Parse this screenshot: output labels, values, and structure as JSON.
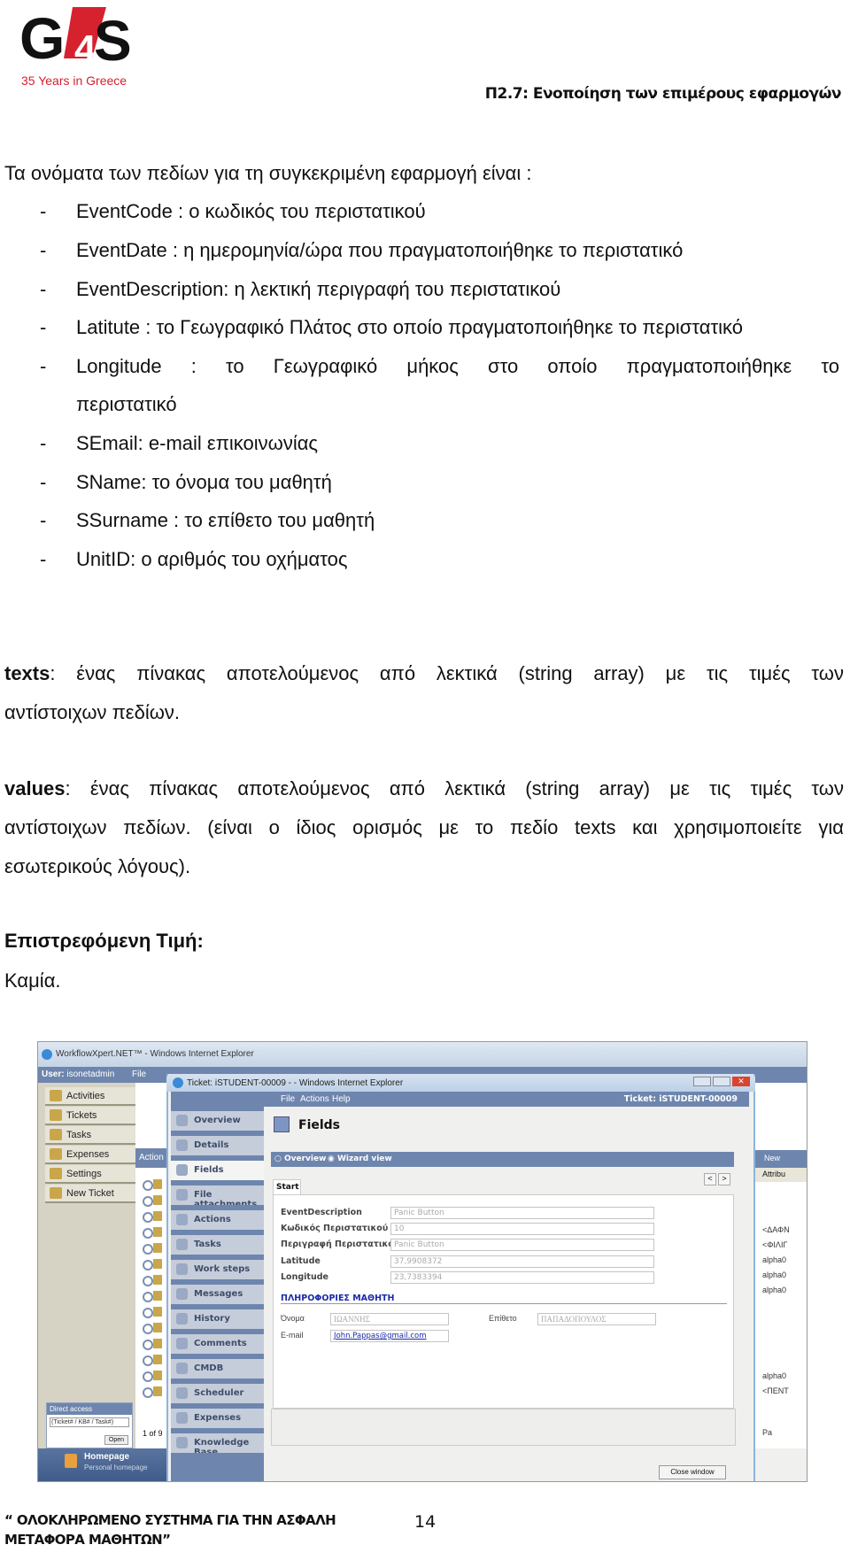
{
  "header": {
    "logo_text": "G4S",
    "logo_tagline": "35 Years in Greece",
    "section_title": "Π2.7: Ενοποίηση των επιμέρους εφαρμογών",
    "brand_red": "#d6212e"
  },
  "body": {
    "intro": "Τα ονόματα των πεδίων για τη συγκεκριμένη εφαρμογή είναι :",
    "fields": [
      {
        "dash": "-",
        "text": "EventCode : ο κωδικός του περιστατικού"
      },
      {
        "dash": "-",
        "text": "EventDate  : η ημερομηνία/ώρα που πραγματοποιήθηκε το περιστατικό"
      },
      {
        "dash": "-",
        "text": "EventDescription: η λεκτική περιγραφή του περιστατικού"
      },
      {
        "dash": "-",
        "text": "Latitute : το Γεωγραφικό Πλάτος στο οποίο πραγματοποιήθηκε το περιστατικό"
      },
      {
        "dash": "-",
        "text": "Longitude : το Γεωγραφικό μήκος στο οποίο πραγματοποιήθηκε το",
        "cont": "περιστατικό"
      },
      {
        "dash": "-",
        "text": "SEmail: e-mail επικοινωνίας"
      },
      {
        "dash": "-",
        "text": "SName: το όνομα του μαθητή"
      },
      {
        "dash": "-",
        "text": "SSurname : το επίθετο του μαθητή"
      },
      {
        "dash": "-",
        "text": "UnitID: ο αριθμός του οχήματος"
      }
    ],
    "texts_term": "texts",
    "texts_line1": ": ένας πίνακας αποτελούμενος από λεκτικά (string array) με τις τιμές των",
    "texts_line2": "αντίστοιχων πεδίων.",
    "values_term": "values",
    "values_line1": ": ένας πίνακας αποτελούμενος από λεκτικά (string array) με τις τιμές των",
    "values_line2": "αντίστοιχων πεδίων. (είναι ο ίδιος ορισμός με το πεδίο texts και χρησιμοποιείτε για",
    "values_line3": "εσωτερικούς λόγους).",
    "return_heading": "Επιστρεφόμενη Τιμή:",
    "return_value": "Καμία."
  },
  "screenshot": {
    "outer_title": "WorkflowXpert.NET™ - Windows Internet Explorer",
    "user_label": "User:",
    "user_name": "isonetadmin",
    "outer_menu_file": "File",
    "sidebar": [
      "Activities",
      "Tickets",
      "Tasks",
      "Expenses",
      "Settings",
      "New Ticket"
    ],
    "action_header": "Action",
    "pager": "1 of 9",
    "direct_access": {
      "title": "Direct access",
      "placeholder": "(Ticket# / KB# / Task#)",
      "open": "Open"
    },
    "homepage": {
      "title": "Homepage",
      "subtitle": "Personal homepage"
    },
    "right_col": {
      "new": "New",
      "attrib": "Attribu",
      "rows": [
        "<ΔΑΦΝ",
        "<ΦΙΛΙΓ",
        "alpha0",
        "alpha0",
        "alpha0",
        "alpha0",
        "<ΠΕΝΤ"
      ],
      "page": "Pa"
    },
    "inner_title": "Ticket: iSTUDENT-00009 - - Windows Internet Explorer",
    "inner_menu": [
      "File",
      "Actions",
      "Help"
    ],
    "ticket_label": "Ticket: iSTUDENT-00009",
    "nav": [
      "Overview",
      "Details",
      "Fields",
      "File attachments",
      "Actions",
      "Tasks",
      "Work steps",
      "Messages",
      "History",
      "Comments",
      "CMDB",
      "Scheduler",
      "Expenses",
      "Knowledge Base"
    ],
    "active_nav": "Fields",
    "page_heading": "Fields",
    "view_options": [
      {
        "label": "Overview",
        "selected": false
      },
      {
        "label": "Wizard view",
        "selected": true
      }
    ],
    "tab": "Start",
    "prev": "<",
    "next": ">",
    "form": [
      {
        "label": "EventDescription",
        "value": "Panic Button"
      },
      {
        "label": "Κωδικός Περιστατικού",
        "value": "10"
      },
      {
        "label": "Περιγραφή Περιστατικού",
        "value": "Panic Button"
      },
      {
        "label": "Latitude",
        "value": "37,9908372"
      },
      {
        "label": "Longitude",
        "value": "23,7383394"
      }
    ],
    "student_section": "ΠΛΗΡΟΦΟΡΙΕΣ ΜΑΘΗΤΗ",
    "name_label": "Όνομα",
    "name_value": "ΙΩΑΝΝΗΣ",
    "surname_label": "Επίθετο",
    "surname_value": "ΠΑΠΑΔΟΠΟΥΛΟΣ",
    "email_label": "E-mail",
    "email_value": "John.Pappas@gmail.com",
    "close_button": "Close window",
    "accent": "#6e86ae"
  },
  "footer": {
    "line1": "“ ΟΛΟΚΛΗΡΩΜΕΝΟ ΣΥΣΤΗΜΑ ΓΙΑ ΤΗΝ ΑΣΦΑΛΗ",
    "line2": "ΜΕΤΑΦΟΡΑ ΜΑΘΗΤΩΝ”",
    "page_number": "14"
  }
}
